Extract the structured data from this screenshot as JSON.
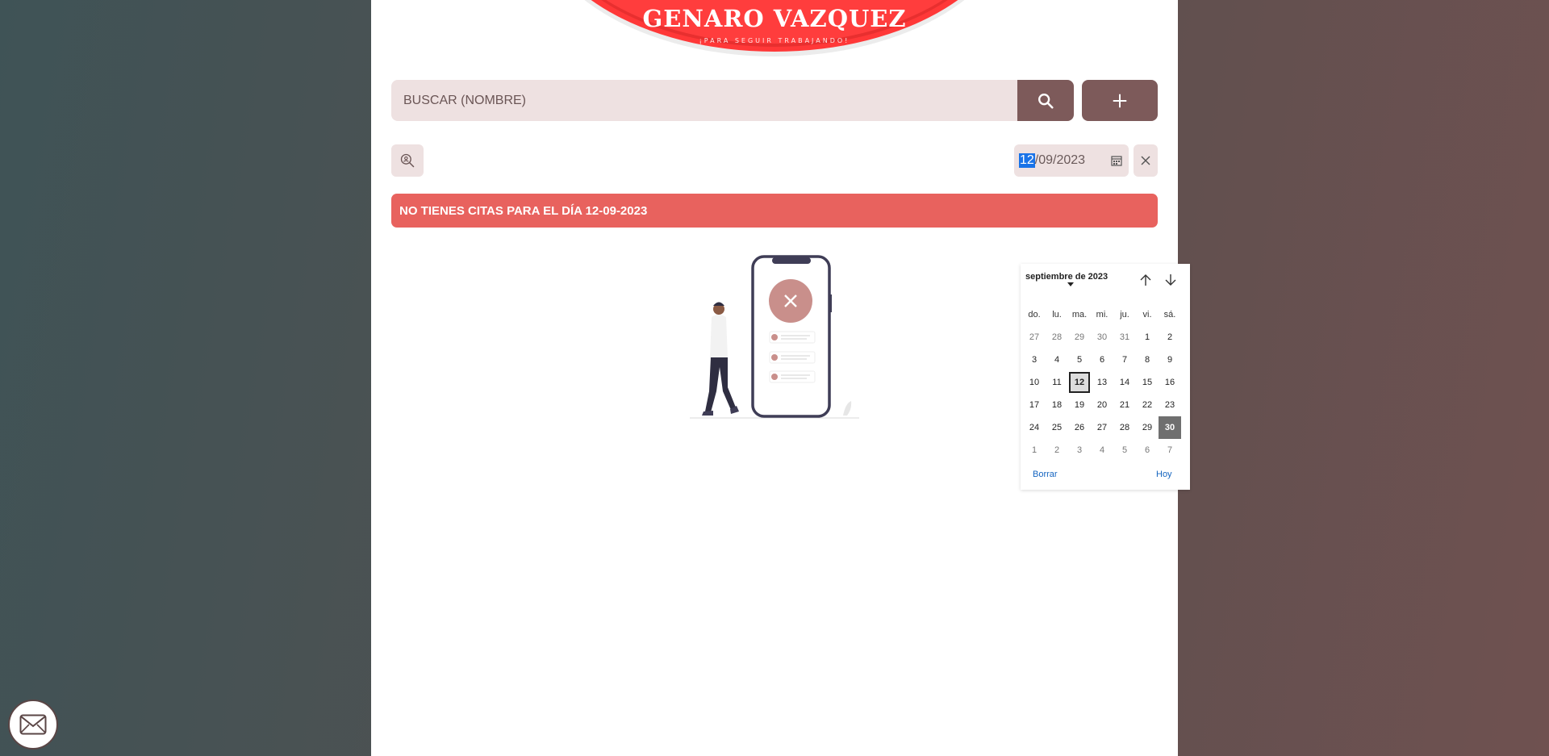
{
  "brand": {
    "title": "GENARO VAZQUEZ",
    "subtitle": "¡PARA SEGUIR TRABAJANDO!"
  },
  "search": {
    "placeholder": "BUSCAR (NOMBRE)",
    "search_icon": "search-icon",
    "add_icon": "plus-icon"
  },
  "filters": {
    "tool_icon": "zoom-person-icon",
    "date_day": "12",
    "date_rest": "/09/2023",
    "calendar_icon": "calendar-icon",
    "clear_icon": "close-icon"
  },
  "alert": {
    "text": "NO TIENES CITAS PARA EL DÍA 12-09-2023"
  },
  "datepicker": {
    "month_label": "septiembre de 2023",
    "weekdays": [
      "do.",
      "lu.",
      "ma.",
      "mi.",
      "ju.",
      "vi.",
      "sá."
    ],
    "weeks": [
      [
        "27",
        "28",
        "29",
        "30",
        "31",
        "1",
        "2"
      ],
      [
        "3",
        "4",
        "5",
        "6",
        "7",
        "8",
        "9"
      ],
      [
        "10",
        "11",
        "12",
        "13",
        "14",
        "15",
        "16"
      ],
      [
        "17",
        "18",
        "19",
        "20",
        "21",
        "22",
        "23"
      ],
      [
        "24",
        "25",
        "26",
        "27",
        "28",
        "29",
        "30"
      ],
      [
        "1",
        "2",
        "3",
        "4",
        "5",
        "6",
        "7"
      ]
    ],
    "selected_day": "12",
    "today_day": "30",
    "clear_label": "Borrar",
    "today_label": "Hoy"
  },
  "colors": {
    "accent_red": "#ff3838",
    "button_brown": "#7d5a5a",
    "alert_red": "#e8625e",
    "field_bg": "#eee1e1"
  },
  "fab": {
    "icon": "mail-icon"
  }
}
